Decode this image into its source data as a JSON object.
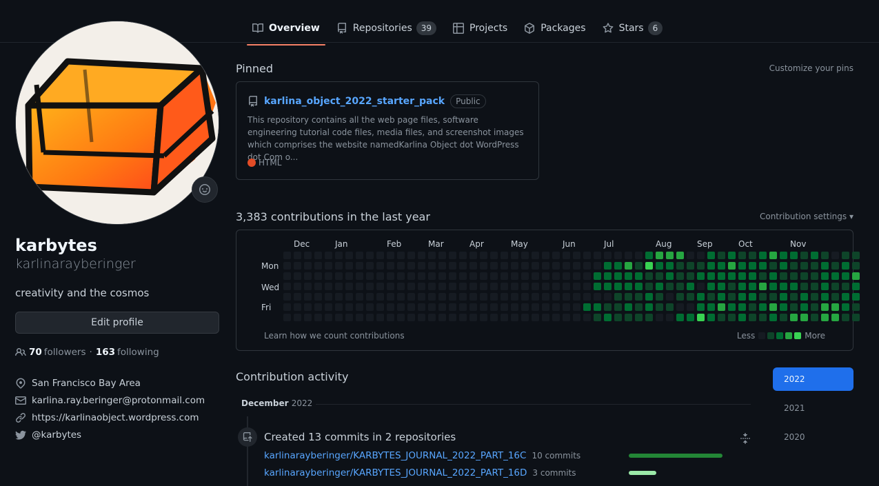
{
  "nav": {
    "tabs": [
      {
        "label": "Overview",
        "icon": "book-icon",
        "active": true
      },
      {
        "label": "Repositories",
        "icon": "repo-icon",
        "count": "39"
      },
      {
        "label": "Projects",
        "icon": "table-icon"
      },
      {
        "label": "Packages",
        "icon": "package-icon"
      },
      {
        "label": "Stars",
        "icon": "star-icon",
        "count": "6"
      }
    ]
  },
  "profile": {
    "name": "karbytes",
    "login": "karlinarayberinger",
    "bio": "creativity and the cosmos",
    "edit_label": "Edit profile",
    "followers_count": "70",
    "followers_label": "followers",
    "separator": "·",
    "following_count": "163",
    "following_label": "following",
    "location": "San Francisco Bay Area",
    "email": "karlina.ray.beringer@protonmail.com",
    "website": "https://karlinaobject.wordpress.com",
    "twitter": "@karbytes"
  },
  "pinned": {
    "title": "Pinned",
    "customize": "Customize your pins",
    "repo": "karlina_object_2022_starter_pack",
    "visibility": "Public",
    "description": "This repository contains all the web page files, software engineering tutorial code files, media files, and screenshot images which comprises the website namedKarlina Object dot WordPress dot Com o...",
    "language": "HTML",
    "language_color": "#e34c26"
  },
  "contributions": {
    "title": "3,383 contributions in the last year",
    "settings": "Contribution settings ▾",
    "months": [
      "Dec",
      "Jan",
      "Feb",
      "Mar",
      "Apr",
      "May",
      "Jun",
      "Jul",
      "Aug",
      "Sep",
      "Oct",
      "Nov"
    ],
    "days": [
      "Mon",
      "Wed",
      "Fri"
    ],
    "learn": "Learn how we count contributions",
    "less": "Less",
    "more": "More",
    "colors": [
      "#161b22",
      "#0e4429",
      "#006d32",
      "#26a641",
      "#39d353"
    ],
    "level_rows": [
      "00000000000000000000000000000000000233300212112322121011",
      "00000000000000000000000000000002231422111223222121112121",
      "00000000000000000000000000000022222112112222221211112223",
      "00000000000000000000000000000022222121120221223222112112",
      "00000000000000000000000000000000111210112121221121212122",
      "00000000000000000000000000000221121211002232212321213321",
      "00000000000000000000000000000012111100224211211213313311"
    ]
  },
  "activity": {
    "title": "Contribution activity",
    "years": [
      "2022",
      "2021",
      "2020"
    ],
    "month": "December",
    "month_year": "2022",
    "commits_title": "Created 13 commits in 2 repositories",
    "repos": [
      {
        "name": "karlinarayberinger/KARBYTES_JOURNAL_2022_PART_16C",
        "count": "10 commits",
        "fraction": 0.77
      },
      {
        "name": "karlinarayberinger/KARBYTES_JOURNAL_2022_PART_16D",
        "count": "3 commits",
        "fraction": 0.23
      }
    ],
    "bar_colors": [
      "#238636",
      "#9be9a8"
    ]
  }
}
